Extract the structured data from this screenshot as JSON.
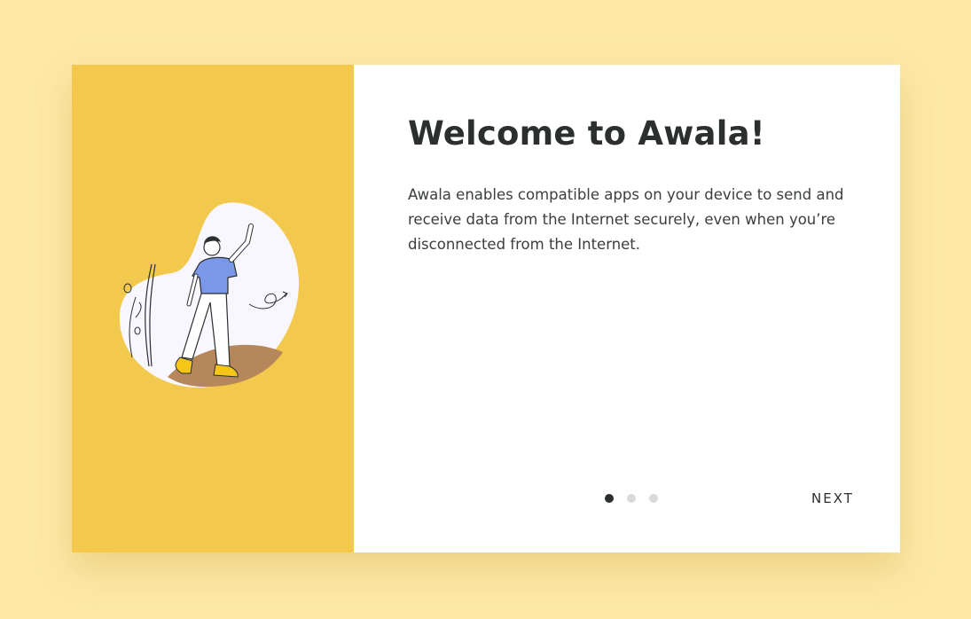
{
  "onboarding": {
    "title": "Welcome to Awala!",
    "description": "Awala enables compatible apps on your device to send and receive data from the Internet securely, even when you’re disconnected from the Internet.",
    "next_label": "NEXT",
    "current_step": 1,
    "total_steps": 3,
    "illustration_icon": "person-waving-illustration"
  },
  "colors": {
    "background": "#fde8a6",
    "accent": "#f2c94c",
    "text": "#2b2f2e",
    "shirt": "#7b98e8",
    "shoes": "#f5c518",
    "ground": "#b5875a"
  }
}
